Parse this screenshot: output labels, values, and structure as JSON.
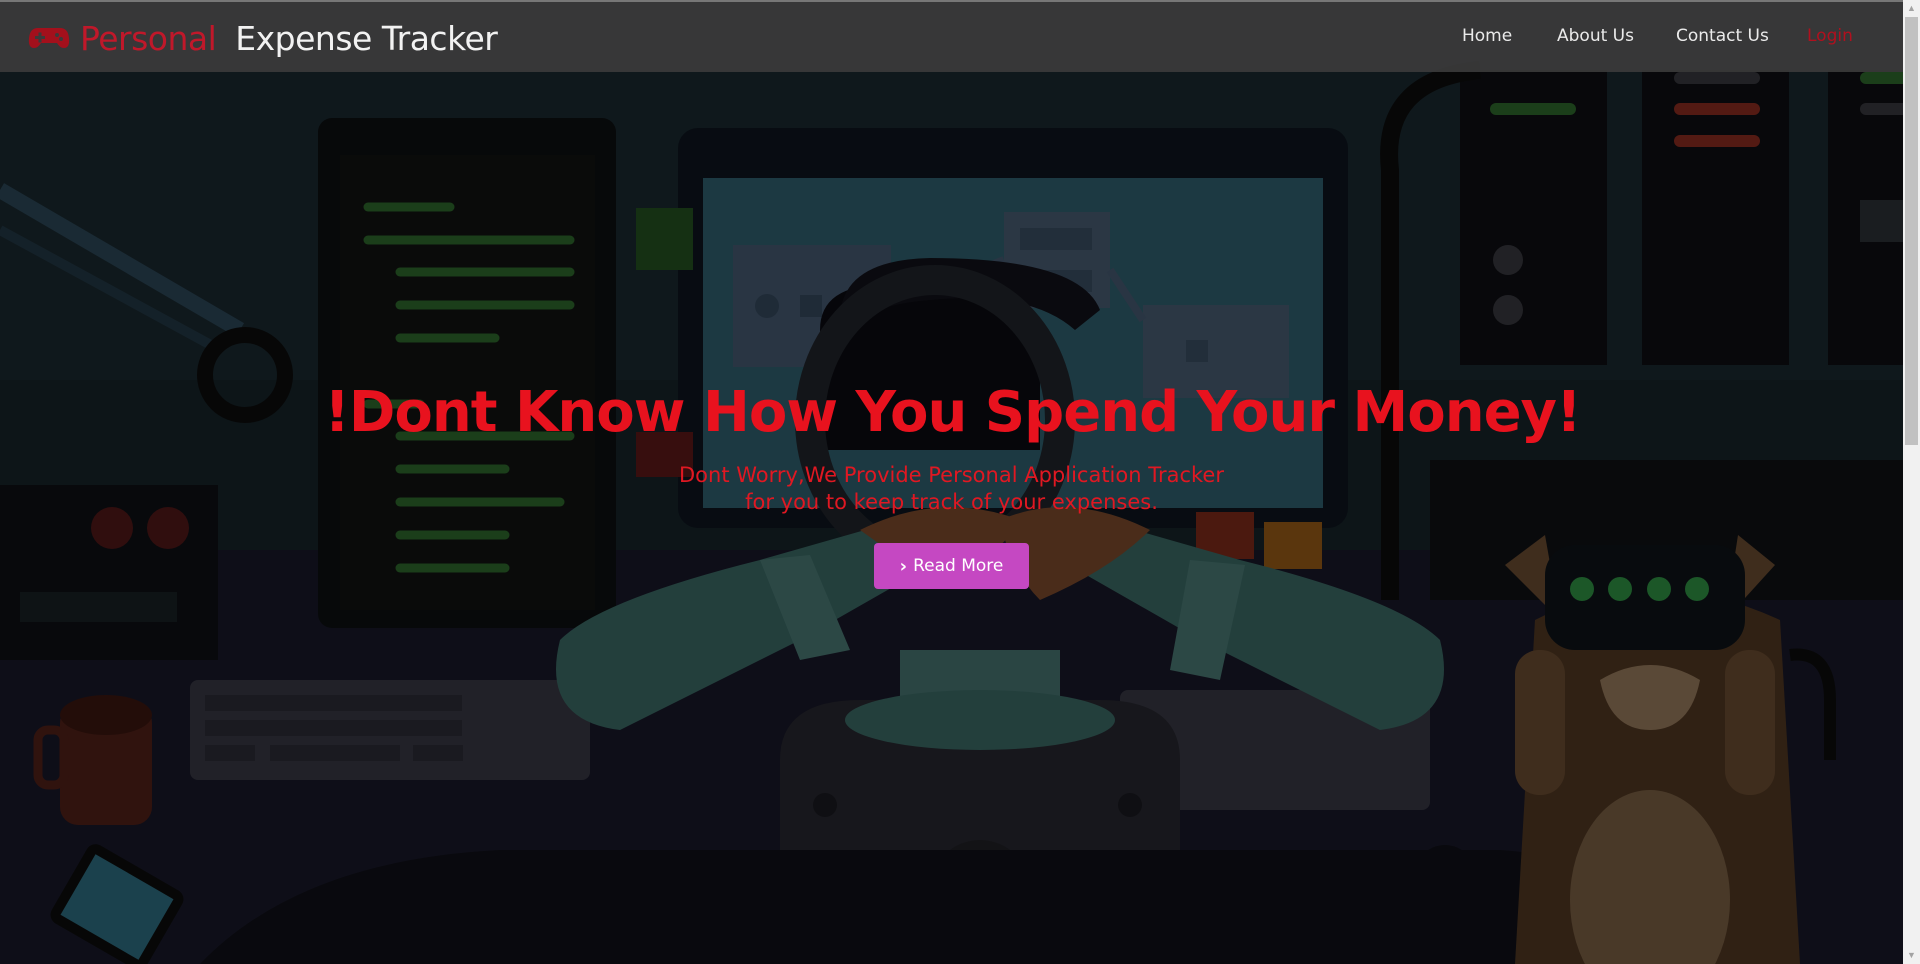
{
  "navbar": {
    "brand_word1": "Personal",
    "brand_word2": "Expense Tracker",
    "brand_icon": "gamepad-icon",
    "links": [
      {
        "label": "Home"
      },
      {
        "label": "About Us"
      },
      {
        "label": "Contact Us"
      },
      {
        "label": "Login"
      }
    ]
  },
  "hero": {
    "headline": "!Dont Know How You Spend Your Money!",
    "subline_1": "Dont Worry,We Provide Personal Application Tracker",
    "subline_2": "for you to keep track of your expenses.",
    "cta_label": "Read More",
    "cta_icon": "chevron-right-icon",
    "background": "illustration-developer-at-desk"
  },
  "colors": {
    "accent_red": "#e8121e",
    "brand_red": "#c0182a",
    "cta_purple": "#c548c2",
    "navbar": "#3a3a3a"
  }
}
